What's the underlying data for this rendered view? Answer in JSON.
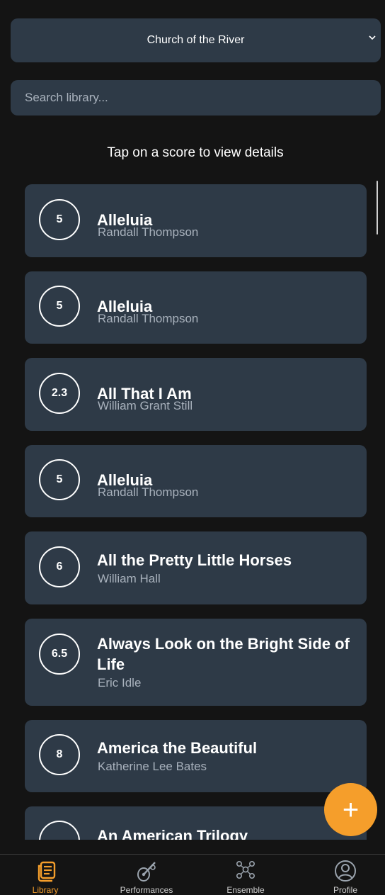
{
  "church_select": {
    "selected": "Church of the River"
  },
  "search": {
    "placeholder": "Search library..."
  },
  "hint": "Tap on a score to view details",
  "scores": [
    {
      "level": "5",
      "title": "Alleluia",
      "composer": "Randall Thompson"
    },
    {
      "level": "5",
      "title": "Alleluia",
      "composer": "Randall Thompson"
    },
    {
      "level": "2.3",
      "title": "All That I Am",
      "composer": "William Grant Still"
    },
    {
      "level": "5",
      "title": "Alleluia",
      "composer": "Randall Thompson"
    },
    {
      "level": "6",
      "title": "All the Pretty Little Horses",
      "composer": "William Hall"
    },
    {
      "level": "6.5",
      "title": "Always Look on the Bright Side of Life",
      "composer": "Eric Idle"
    },
    {
      "level": "8",
      "title": "America the Beautiful",
      "composer": "Katherine Lee Bates"
    },
    {
      "level": "",
      "title": "An American Trilogy",
      "composer": ""
    }
  ],
  "fab": {
    "symbol": "+"
  },
  "nav": {
    "items": [
      {
        "label": "Library",
        "icon": "library-icon",
        "active": true
      },
      {
        "label": "Performances",
        "icon": "performances-icon",
        "active": false
      },
      {
        "label": "Ensemble",
        "icon": "ensemble-icon",
        "active": false
      },
      {
        "label": "Profile",
        "icon": "profile-icon",
        "active": false
      }
    ]
  },
  "colors": {
    "accent": "#f59e2b",
    "card": "#2e3a47",
    "background": "#141414",
    "muted_text": "#a8b1bc"
  }
}
